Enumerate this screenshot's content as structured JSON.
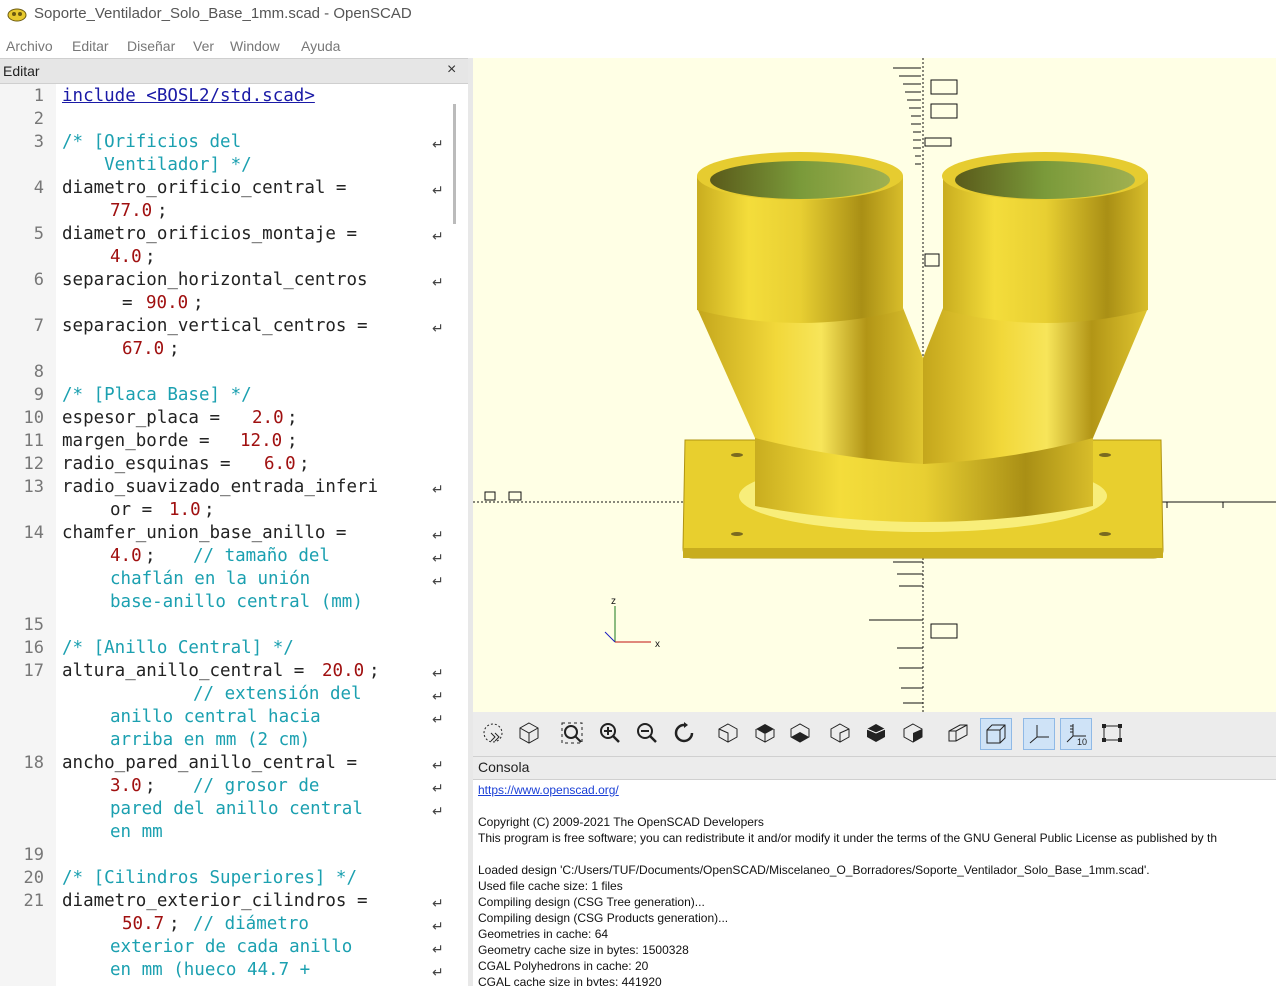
{
  "window": {
    "title": "Soporte_Ventilador_Solo_Base_1mm.scad - OpenSCAD"
  },
  "menu": [
    "Archivo",
    "Editar",
    "Diseñar",
    "Ver",
    "Window",
    "Ayuda"
  ],
  "editor": {
    "title": "Editar",
    "close": "×",
    "line_numbers": [
      "1",
      "2",
      "3",
      "4",
      "5",
      "6",
      "7",
      "8",
      "9",
      "10",
      "11",
      "12",
      "13",
      "14",
      "15",
      "16",
      "17",
      "18",
      "19",
      "20",
      "21"
    ]
  },
  "code": {
    "l1": "include <BOSL2/std.scad>",
    "l3a": "/* [Orificios del",
    "l3b": "    Ventilador] */",
    "l4a": "diametro_orificio_central =",
    "l4b": "77.0",
    "l5a": "diametro_orificios_montaje =",
    "l5b": "4.0",
    "l6a": "separacion_horizontal_centros",
    "l6b": "= ",
    "l6c": "90.0",
    "l7a": "separacion_vertical_centros =",
    "l7b": "67.0",
    "l9": "/* [Placa Base] */",
    "l10a": "espesor_placa = ",
    "l10b": "2.0",
    "l11a": "margen_borde = ",
    "l11b": "12.0",
    "l12a": "radio_esquinas = ",
    "l12b": "6.0",
    "l13a": "radio_suavizado_entrada_inferi",
    "l13b": "or = ",
    "l13c": "1.0",
    "l14a": "chamfer_union_base_anillo =",
    "l14b": "4.0",
    "l14c": "// tamaño del",
    "l14d": "chaflán en la unión",
    "l14e": "base-anillo central (mm)",
    "l16": "/* [Anillo Central] */",
    "l17a": "altura_anillo_central = ",
    "l17b": "20.0",
    "l17c": "// extensión del",
    "l17d": "anillo central hacia",
    "l17e": "arriba en mm (2 cm)",
    "l18a": "ancho_pared_anillo_central =",
    "l18b": "3.0",
    "l18c": "// grosor de",
    "l18d": "pared del anillo central",
    "l18e": "en mm",
    "l20": "/* [Cilindros Superiores] */",
    "l21a": "diametro_exterior_cilindros =",
    "l21b": "50.7",
    "l21c": "// diámetro",
    "l21d": "exterior de cada anillo",
    "l21e": "en mm (hueco 44.7 +"
  },
  "viewport": {
    "axis_z": "z",
    "axis_x": "x",
    "ruler_label": "10",
    "model_color": "#f2d83a",
    "background": "#ffffe5"
  },
  "toolbar": {
    "buttons": [
      "preview-icon",
      "render-icon",
      "view-all-icon",
      "zoom-in-icon",
      "zoom-out-icon",
      "reset-view-icon",
      "view-right-icon",
      "view-top-icon",
      "view-bottom-icon",
      "view-left-icon",
      "view-front-icon",
      "view-back-icon",
      "perspective-icon",
      "orthogonal-icon",
      "show-axes-icon",
      "show-scale-icon",
      "show-edges-icon"
    ]
  },
  "console": {
    "title": "Consola",
    "link": "https://www.openscad.org/",
    "lines": [
      "Copyright (C) 2009-2021 The OpenSCAD Developers",
      "This program is free software; you can redistribute it and/or modify it under the terms of the GNU General Public License as published by th",
      "",
      "Loaded design 'C:/Users/TUF/Documents/OpenSCAD/Miscelaneo_O_Borradores/Soporte_Ventilador_Solo_Base_1mm.scad'.",
      "Used file cache size: 1 files",
      "Compiling design (CSG Tree generation)...",
      "Compiling design (CSG Products generation)...",
      "Geometries in cache: 64",
      "Geometry cache size in bytes: 1500328",
      "CGAL Polyhedrons in cache: 20",
      "CGAL cache size in bytes: 441920"
    ]
  }
}
